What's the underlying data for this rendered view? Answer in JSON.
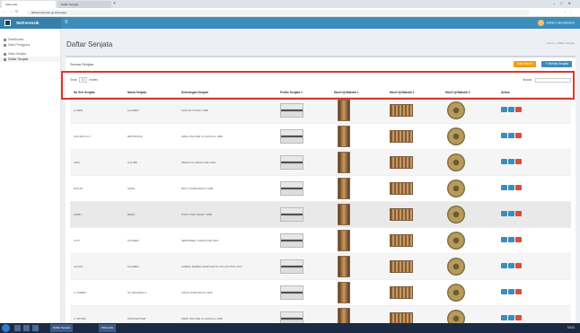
{
  "browser": {
    "tabs": [
      "Siforensik",
      "Daftar Senjata"
    ],
    "url": "labforensik.polri.go.id/senjata"
  },
  "app": {
    "brand": "SIsForensik",
    "user": "Admin Laboratorium"
  },
  "sidebar": {
    "items": [
      {
        "label": "Dashboard"
      },
      {
        "label": "Data Pengguna"
      },
      {
        "label": "Data Senjata"
      },
      {
        "label": "Daftar Senjata"
      }
    ]
  },
  "page": {
    "title": "Daftar Senjata",
    "breadcrumb": "Home > Daftar Senjata"
  },
  "box": {
    "title": "Semua Senjata",
    "export_label": "Data Export",
    "add_label": "+ Tambah Senjata"
  },
  "tablebar": {
    "show_label": "Show",
    "show_value": "10",
    "entries_label": "entries",
    "search_label": "Search:"
  },
  "table": {
    "headers": [
      "No Seri Senjata",
      "Nama Senjata",
      "Keterangan Senjata",
      "Profile Senjata 1",
      "Hasil Uji Balistik 1",
      "Hasil Uji Balistik 2",
      "Hasil Uji Balistik 3",
      "Action"
    ],
    "rows": [
      {
        "no_seri": "C70981",
        "nama": "KALIBER",
        "ket": "GRIS ROYO/DO 1988"
      },
      {
        "no_seri": "G25-9PR-CL7",
        "nama": "BROWNING",
        "ket": "HBML WALTER CLASSICAL 1988"
      },
      {
        "no_seri": "A251",
        "nama": "GALIBE",
        "ket": "SENDAYA JANGKUNE 1991"
      },
      {
        "no_seri": "B21126",
        "nama": "SWIFI",
        "ket": "BODY PARESWATO 1988"
      },
      {
        "no_seri": "G0887",
        "nama": "BERO",
        "ket": "PISTO TER TENRY 1988"
      },
      {
        "no_seri": "A727",
        "nama": "KALIBER",
        "ket": "SERAMBEK JANGKUNE 1991"
      },
      {
        "no_seri": "A15123",
        "nama": "KALIBER",
        "ket": "GABRIL BERBO HIDROSOTO KOLAOOTAS 1977"
      },
      {
        "no_seri": "C TD8880",
        "nama": "C2 SENAPAN 3",
        "ket": "CROK NOROSPHO 1988"
      },
      {
        "no_seri": "C SD7990",
        "nama": "WINCHESTER",
        "ket": "HBML WALTER CLASSICAL 1988"
      }
    ]
  },
  "taskbar": {
    "windows": [
      "Daftar Senjata",
      "Siforensik"
    ],
    "clock": "10:21"
  },
  "colors": {
    "header": "#3c8dbc",
    "highlight": "#d9382e",
    "export": "#f39c12",
    "delete": "#dd4b39"
  }
}
